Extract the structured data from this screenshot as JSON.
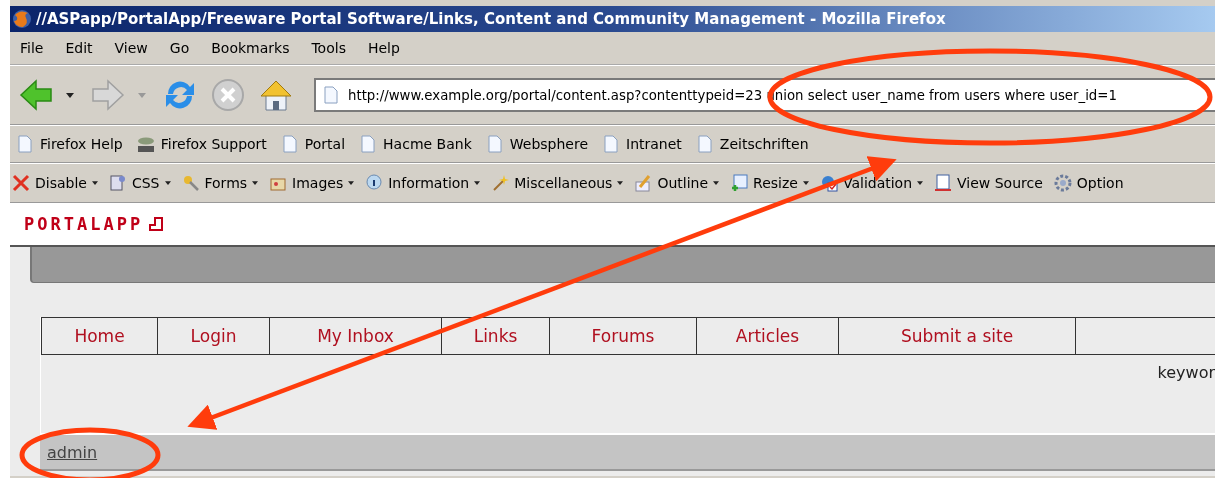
{
  "window": {
    "title": "//ASPapp/PortalApp/Freeware Portal Software/Links, Content and Community Management - Mozilla Firefox"
  },
  "menu": [
    "File",
    "Edit",
    "View",
    "Go",
    "Bookmarks",
    "Tools",
    "Help"
  ],
  "address_bar": {
    "value": "http://www.example.org/portal/content.asp?contenttypeid=23 union select user_name from users where user_id=1"
  },
  "bookmarks": [
    {
      "label": "Firefox Help",
      "kind": "page"
    },
    {
      "label": "Firefox Support",
      "kind": "zine"
    },
    {
      "label": "Portal",
      "kind": "page"
    },
    {
      "label": "Hacme Bank",
      "kind": "page"
    },
    {
      "label": "Websphere",
      "kind": "page"
    },
    {
      "label": "Intranet",
      "kind": "page"
    },
    {
      "label": "Zeitschriften",
      "kind": "page"
    }
  ],
  "dev_toolbar": [
    {
      "label": "Disable",
      "dropdown": true
    },
    {
      "label": "CSS",
      "dropdown": true
    },
    {
      "label": "Forms",
      "dropdown": true
    },
    {
      "label": "Images",
      "dropdown": true
    },
    {
      "label": "Information",
      "dropdown": true
    },
    {
      "label": "Miscellaneous",
      "dropdown": true
    },
    {
      "label": "Outline",
      "dropdown": true
    },
    {
      "label": "Resize",
      "dropdown": true
    },
    {
      "label": "Validation",
      "dropdown": true
    },
    {
      "label": "View Source",
      "dropdown": false
    },
    {
      "label": "Option",
      "dropdown": false
    }
  ],
  "page": {
    "logo": "PORTALAPP",
    "nav": [
      "Home",
      "Login",
      "My Inbox",
      "Links",
      "Forums",
      "Articles",
      "Submit a site"
    ],
    "search_label": "keywor",
    "user_link": "admin"
  }
}
